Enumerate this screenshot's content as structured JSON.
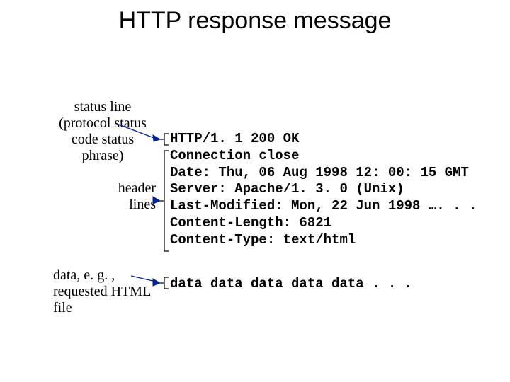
{
  "title": "HTTP response message",
  "labels": {
    "status": "status line\n(protocol\nstatus code\nstatus phrase)",
    "header": "header\nlines",
    "data": "data, e. g. ,\nrequested\nHTML file"
  },
  "code": {
    "block": "HTTP/1. 1 200 OK\nConnection close\nDate: Thu, 06 Aug 1998 12: 00: 15 GMT\nServer: Apache/1. 3. 0 (Unix)\nLast-Modified: Mon, 22 Jun 1998 …. . .\nContent-Length: 6821\nContent-Type: text/html",
    "data": "data data data data data . . ."
  }
}
